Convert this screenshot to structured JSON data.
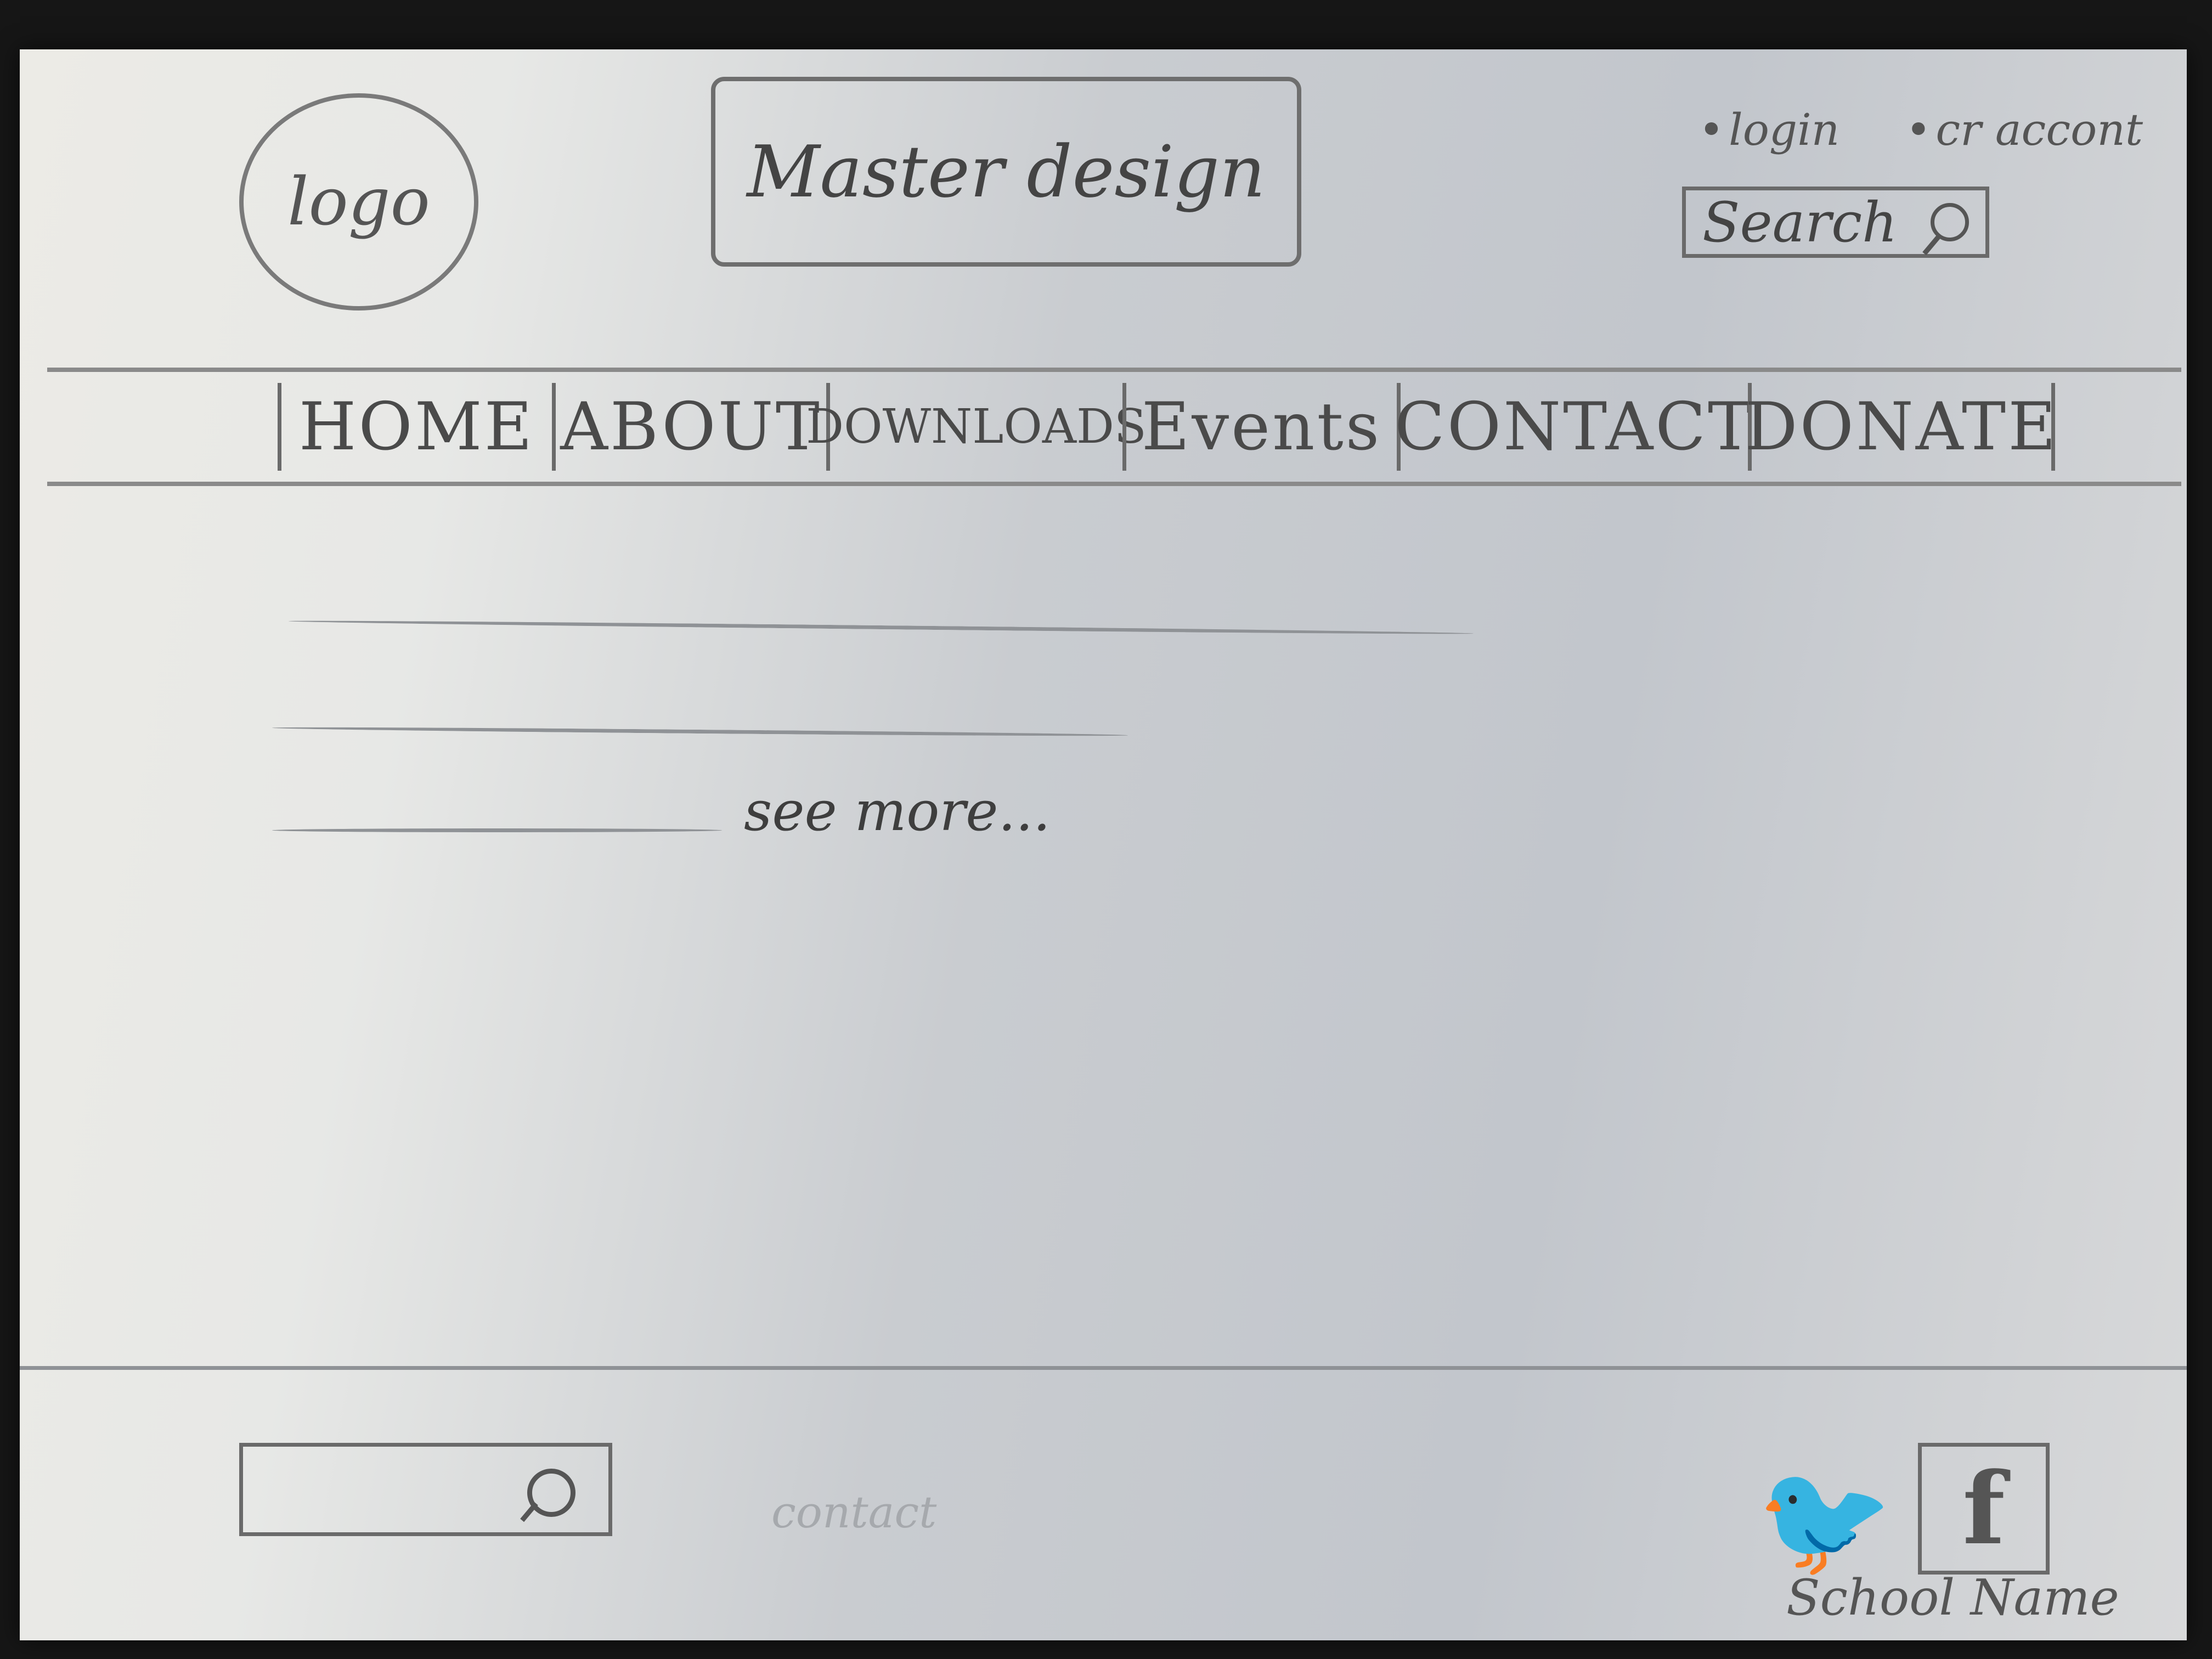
{
  "header": {
    "logo_text": "logo",
    "title": "Master design",
    "top_links": [
      "login",
      "cr accont"
    ],
    "search_label": "Search"
  },
  "nav": {
    "items": [
      "HOME",
      "ABOUT",
      "DOWNLOADS",
      "Events",
      "CONTACT",
      "DONATE"
    ]
  },
  "content": {
    "see_more": "see more..."
  },
  "footer": {
    "contact_label": "contact",
    "school_name": "School Name",
    "twitter_icon": "twitter-bird-icon",
    "facebook_icon": "facebook-f-icon"
  }
}
